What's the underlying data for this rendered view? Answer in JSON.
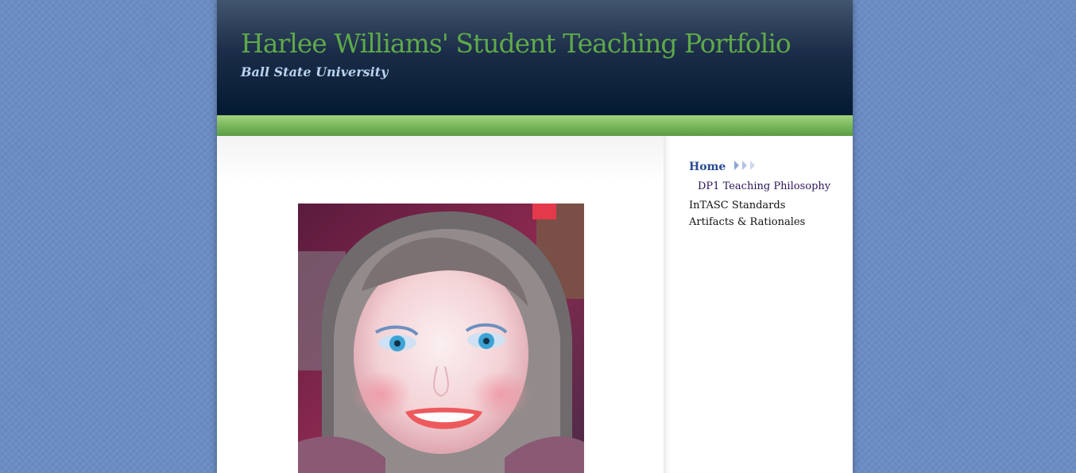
{
  "header": {
    "title": "Harlee Williams' Student Teaching Portfolio",
    "subtitle": "Ball State University"
  },
  "nav": {
    "items": [
      {
        "label": "Home",
        "current": true
      },
      {
        "label": "DP1 Teaching Philosophy",
        "subpage": true
      },
      {
        "label": "InTASC Standards"
      },
      {
        "label": "Artifacts & Rationales"
      }
    ]
  },
  "colors": {
    "page_background": "#6a8cc4",
    "title_green": "#5ea94a",
    "subtitle_blue": "#b9d3ee",
    "header_dark": "#031a33",
    "nav_active": "#2a4a93"
  },
  "main": {
    "photo_icon": "portrait-photo"
  }
}
